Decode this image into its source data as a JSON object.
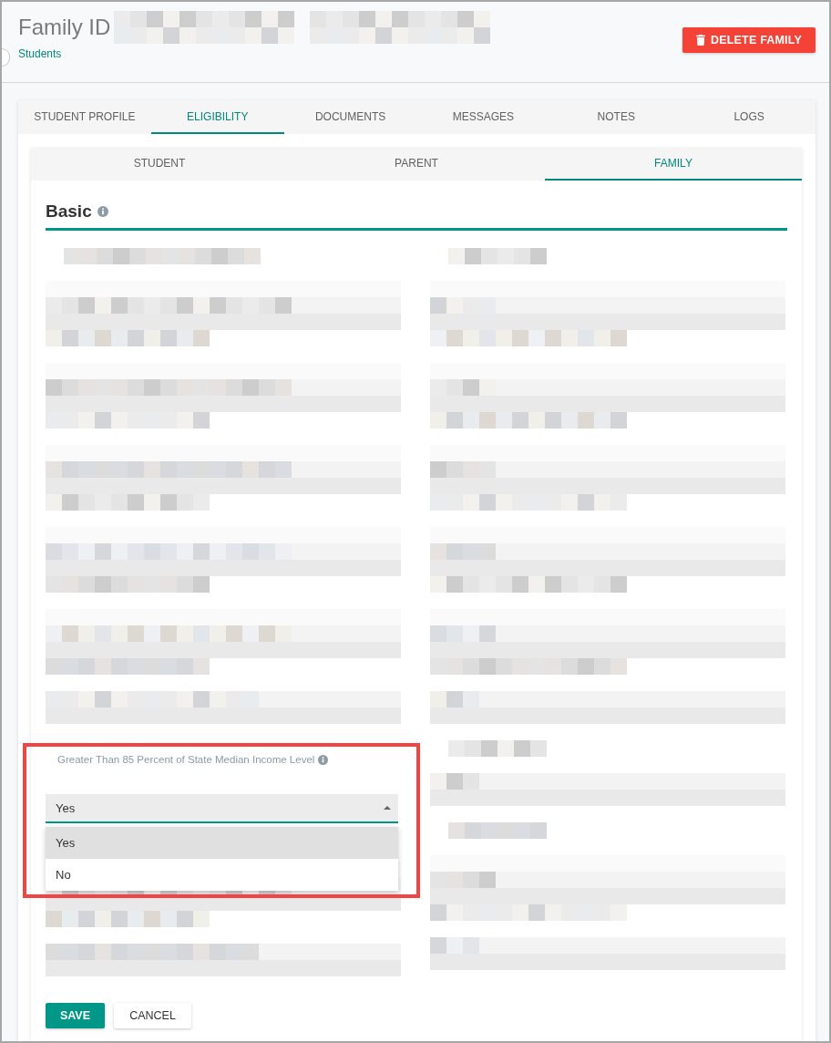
{
  "header": {
    "title": "Family ID",
    "id_redacted": true,
    "breadcrumb": "Students",
    "delete_button": "DELETE FAMILY"
  },
  "tabs": [
    {
      "label": "STUDENT PROFILE",
      "selected": false
    },
    {
      "label": "ELIGIBILITY",
      "selected": true
    },
    {
      "label": "DOCUMENTS",
      "selected": false
    },
    {
      "label": "MESSAGES",
      "selected": false
    },
    {
      "label": "NOTES",
      "selected": false
    },
    {
      "label": "LOGS",
      "selected": false
    }
  ],
  "subtabs": [
    {
      "label": "STUDENT",
      "selected": false
    },
    {
      "label": "PARENT",
      "selected": false
    },
    {
      "label": "FAMILY",
      "selected": true
    }
  ],
  "section": {
    "title": "Basic",
    "info": true
  },
  "form": {
    "left": [
      {
        "kind": "redacted_label"
      },
      {
        "kind": "redacted_field"
      },
      {
        "kind": "redacted_field"
      },
      {
        "kind": "redacted_field"
      },
      {
        "kind": "redacted_field"
      },
      {
        "kind": "redacted_field"
      },
      {
        "kind": "redacted_input"
      },
      {
        "kind": "select",
        "label": "Greater Than 85 Percent of State Median Income Level",
        "info": true,
        "value": "Yes",
        "expanded": true,
        "highlighted": true,
        "options": [
          {
            "label": "Yes",
            "selected": true
          },
          {
            "label": "No",
            "selected": false
          }
        ]
      },
      {
        "kind": "redacted_field"
      },
      {
        "kind": "redacted_input"
      }
    ],
    "right": [
      {
        "kind": "redacted_label"
      },
      {
        "kind": "redacted_field"
      },
      {
        "kind": "redacted_field"
      },
      {
        "kind": "redacted_field"
      },
      {
        "kind": "redacted_field"
      },
      {
        "kind": "redacted_field"
      },
      {
        "kind": "redacted_input"
      },
      {
        "kind": "redacted_label"
      },
      {
        "kind": "redacted_input"
      },
      {
        "kind": "redacted_label"
      },
      {
        "kind": "redacted_field"
      },
      {
        "kind": "redacted_input"
      }
    ]
  },
  "actions": [
    {
      "label": "SAVE",
      "kind": "primary"
    },
    {
      "label": "CANCEL",
      "kind": "secondary"
    }
  ]
}
